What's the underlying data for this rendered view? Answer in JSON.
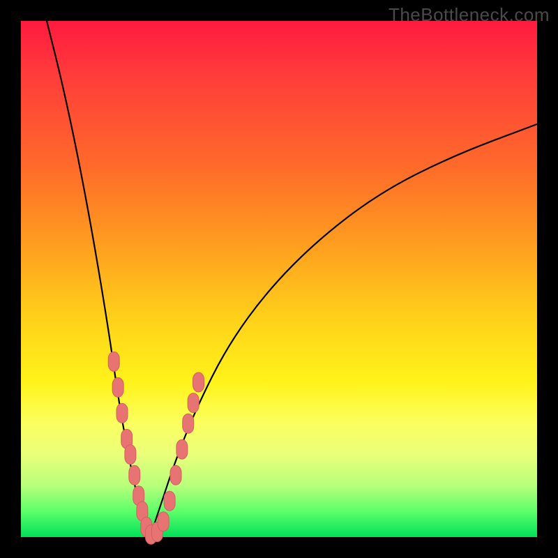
{
  "watermark": "TheBottleneck.com",
  "colors": {
    "frame": "#000000",
    "marker_fill": "#e77373",
    "marker_stroke": "#d45f5f",
    "curve": "#000000",
    "gradient_stops": [
      "#ff1a3f",
      "#ff6a2a",
      "#ffd21a",
      "#fbff60",
      "#b8ff7a",
      "#00e05a"
    ]
  },
  "chart_data": {
    "type": "line",
    "title": "",
    "xlabel": "",
    "ylabel": "",
    "xlim": [
      0,
      100
    ],
    "ylim": [
      0,
      100
    ],
    "note": "No axes, ticks, or numeric labels are rendered. Values are estimated from pixel positions on a 0–100 normalized scale for each axis. y is bottleneck percentage (0 at bottom / green, 100 at top / red). The two curves form a V with minimum near x≈24.",
    "series": [
      {
        "name": "left-curve",
        "x": [
          5,
          8,
          11,
          14,
          17,
          19,
          21,
          22.5,
          24,
          25
        ],
        "y": [
          100,
          88,
          74,
          58,
          40,
          26,
          15,
          8,
          2,
          0
        ]
      },
      {
        "name": "right-curve",
        "x": [
          25,
          27,
          30,
          34,
          40,
          48,
          58,
          70,
          84,
          100
        ],
        "y": [
          0,
          6,
          15,
          25,
          37,
          48,
          58,
          67,
          74,
          80
        ]
      }
    ],
    "markers": {
      "name": "highlighted-points",
      "note": "Salmon rounded markers clustered near the valley on both arms.",
      "points": [
        {
          "x": 18.0,
          "y": 34
        },
        {
          "x": 18.8,
          "y": 29
        },
        {
          "x": 19.6,
          "y": 24
        },
        {
          "x": 20.5,
          "y": 19
        },
        {
          "x": 21.2,
          "y": 16
        },
        {
          "x": 22.0,
          "y": 12
        },
        {
          "x": 22.8,
          "y": 8
        },
        {
          "x": 23.5,
          "y": 5
        },
        {
          "x": 24.3,
          "y": 2
        },
        {
          "x": 25.2,
          "y": 0.5
        },
        {
          "x": 26.4,
          "y": 1
        },
        {
          "x": 27.6,
          "y": 3
        },
        {
          "x": 28.8,
          "y": 7
        },
        {
          "x": 30.0,
          "y": 12
        },
        {
          "x": 31.2,
          "y": 17
        },
        {
          "x": 32.4,
          "y": 22
        },
        {
          "x": 33.4,
          "y": 26
        },
        {
          "x": 34.4,
          "y": 30
        }
      ]
    }
  }
}
